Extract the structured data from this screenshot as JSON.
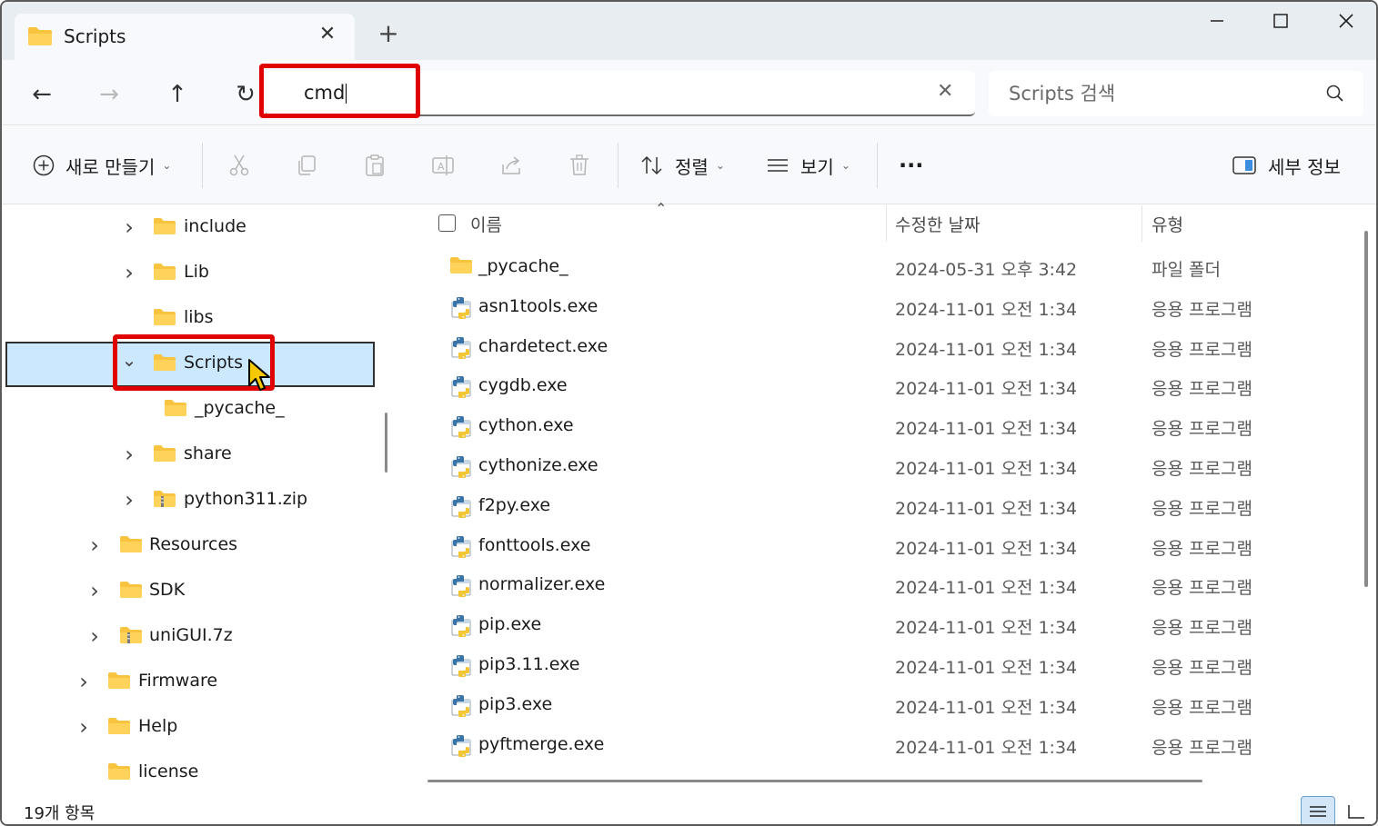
{
  "tab": {
    "title": "Scripts",
    "close_glyph": "✕",
    "new_tab_glyph": "+"
  },
  "window_controls": {
    "minimize": "—",
    "maximize": "☐",
    "close": "✕"
  },
  "nav": {
    "back": "←",
    "forward": "→",
    "up": "↑",
    "refresh": "↻"
  },
  "address": {
    "value": "cmd",
    "clear_glyph": "✕"
  },
  "search": {
    "placeholder": "Scripts 검색"
  },
  "toolbar": {
    "new_label": "새로 만들기",
    "sort_label": "정렬",
    "view_label": "보기",
    "more_glyph": "···",
    "details_label": "세부 정보"
  },
  "tree": [
    {
      "label": "include",
      "expandable": true,
      "selected": false,
      "icon": "folder-icon"
    },
    {
      "label": "Lib",
      "expandable": true,
      "selected": false,
      "icon": "folder-icon"
    },
    {
      "label": "libs",
      "expandable": false,
      "selected": false,
      "icon": "folder-icon"
    },
    {
      "label": "Scripts",
      "expandable": true,
      "expanded": true,
      "selected": true,
      "icon": "folder-icon"
    },
    {
      "label": "_pycache_",
      "expandable": false,
      "selected": false,
      "icon": "folder-icon"
    },
    {
      "label": "share",
      "expandable": true,
      "selected": false,
      "icon": "folder-icon"
    },
    {
      "label": "python311.zip",
      "expandable": true,
      "selected": false,
      "icon": "zip-folder-icon"
    },
    {
      "label": "Resources",
      "expandable": true,
      "selected": false,
      "icon": "folder-icon"
    },
    {
      "label": "SDK",
      "expandable": true,
      "selected": false,
      "icon": "folder-icon"
    },
    {
      "label": "uniGUI.7z",
      "expandable": true,
      "selected": false,
      "icon": "zip-folder-icon"
    },
    {
      "label": "Firmware",
      "expandable": true,
      "selected": false,
      "icon": "folder-icon"
    },
    {
      "label": "Help",
      "expandable": true,
      "selected": false,
      "icon": "folder-icon"
    },
    {
      "label": "license",
      "expandable": false,
      "selected": false,
      "icon": "folder-icon"
    }
  ],
  "columns": {
    "name": "이름",
    "date": "수정한 날짜",
    "type": "유형"
  },
  "files": [
    {
      "name": "_pycache_",
      "date": "2024-05-31 오후 3:42",
      "type": "파일 폴더",
      "icon": "folder-icon"
    },
    {
      "name": "asn1tools.exe",
      "date": "2024-11-01 오전 1:34",
      "type": "응용 프로그램",
      "icon": "python-exe-icon"
    },
    {
      "name": "chardetect.exe",
      "date": "2024-11-01 오전 1:34",
      "type": "응용 프로그램",
      "icon": "python-exe-icon"
    },
    {
      "name": "cygdb.exe",
      "date": "2024-11-01 오전 1:34",
      "type": "응용 프로그램",
      "icon": "python-exe-icon"
    },
    {
      "name": "cython.exe",
      "date": "2024-11-01 오전 1:34",
      "type": "응용 프로그램",
      "icon": "python-exe-icon"
    },
    {
      "name": "cythonize.exe",
      "date": "2024-11-01 오전 1:34",
      "type": "응용 프로그램",
      "icon": "python-exe-icon"
    },
    {
      "name": "f2py.exe",
      "date": "2024-11-01 오전 1:34",
      "type": "응용 프로그램",
      "icon": "python-exe-icon"
    },
    {
      "name": "fonttools.exe",
      "date": "2024-11-01 오전 1:34",
      "type": "응용 프로그램",
      "icon": "python-exe-icon"
    },
    {
      "name": "normalizer.exe",
      "date": "2024-11-01 오전 1:34",
      "type": "응용 프로그램",
      "icon": "python-exe-icon"
    },
    {
      "name": "pip.exe",
      "date": "2024-11-01 오전 1:34",
      "type": "응용 프로그램",
      "icon": "python-exe-icon"
    },
    {
      "name": "pip3.11.exe",
      "date": "2024-11-01 오전 1:34",
      "type": "응용 프로그램",
      "icon": "python-exe-icon"
    },
    {
      "name": "pip3.exe",
      "date": "2024-11-01 오전 1:34",
      "type": "응용 프로그램",
      "icon": "python-exe-icon"
    },
    {
      "name": "pyftmerge.exe",
      "date": "2024-11-01 오전 1:34",
      "type": "응용 프로그램",
      "icon": "python-exe-icon"
    }
  ],
  "status": {
    "item_count": "19개 항목"
  },
  "colors": {
    "highlight": "#e00000",
    "selection": "#cce8ff",
    "folder": "#f8c440",
    "cursor": "#f5c800"
  }
}
